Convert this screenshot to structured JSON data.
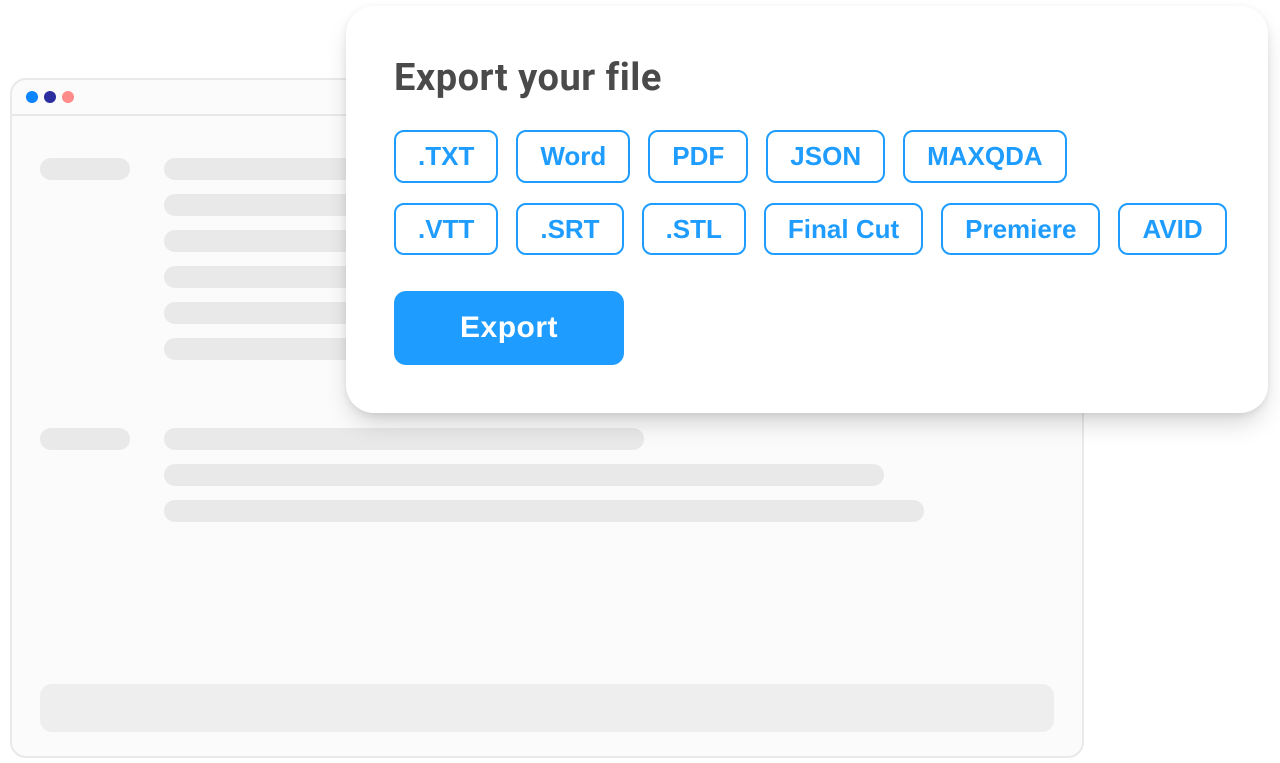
{
  "export": {
    "title": "Export your file",
    "formats_row1": [
      ".TXT",
      "Word",
      "PDF",
      "JSON",
      "MAXQDA"
    ],
    "formats_row2": [
      ".VTT",
      ".SRT",
      ".STL",
      "Final Cut",
      "Premiere",
      "AVID"
    ],
    "button_label": "Export"
  }
}
